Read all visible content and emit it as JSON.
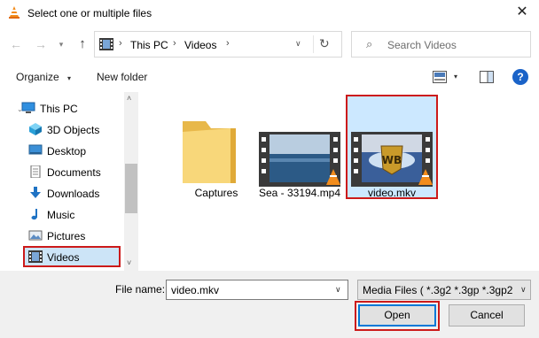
{
  "window": {
    "title": "Select one or multiple files",
    "close_glyph": "✕",
    "app_icon": "vlc-cone-icon"
  },
  "navigation": {
    "back_glyph": "←",
    "forward_glyph": "→",
    "recent_glyph": "▾",
    "up_glyph": "↑",
    "breadcrumbs": [
      "This PC",
      "Videos"
    ],
    "breadcrumb_separator": "›",
    "refresh_glyph": "↻",
    "dropdown_glyph": "∨"
  },
  "search": {
    "placeholder": "Search Videos",
    "icon_glyph": "⌕"
  },
  "toolbar": {
    "organize_label": "Organize",
    "new_folder_label": "New folder",
    "help_label": "?",
    "caret_glyph": "▾"
  },
  "sidebar": {
    "items": [
      {
        "label": "This PC",
        "icon": "computer-icon",
        "expander": "⌄"
      },
      {
        "label": "3D Objects",
        "icon": "cube-icon"
      },
      {
        "label": "Desktop",
        "icon": "desktop-icon"
      },
      {
        "label": "Documents",
        "icon": "documents-icon"
      },
      {
        "label": "Downloads",
        "icon": "download-arrow-icon"
      },
      {
        "label": "Music",
        "icon": "music-note-icon"
      },
      {
        "label": "Pictures",
        "icon": "pictures-icon"
      },
      {
        "label": "Videos",
        "icon": "film-strip-icon",
        "selected": true
      }
    ],
    "scroll_up_glyph": "˄",
    "scroll_down_glyph": "˅"
  },
  "files": [
    {
      "name": "Captures",
      "type": "folder",
      "icon": "folder-icon"
    },
    {
      "name": "Sea - 33194.mp4",
      "type": "video",
      "icon": "video-thumbnail-sea"
    },
    {
      "name": "video.mkv",
      "type": "video",
      "icon": "video-thumbnail-wb",
      "selected": true
    }
  ],
  "footer": {
    "file_name_label": "File name:",
    "file_name_value": "video.mkv",
    "file_type_value": "Media Files ( *.3g2 *.3gp *.3gp2",
    "open_label": "Open",
    "cancel_label": "Cancel",
    "dropdown_glyph": "∨"
  },
  "colors": {
    "selection_bg": "#cce8ff",
    "highlight_red": "#cc1a1a",
    "accent_blue": "#0078d7",
    "footer_bg": "#f0f0f0"
  }
}
